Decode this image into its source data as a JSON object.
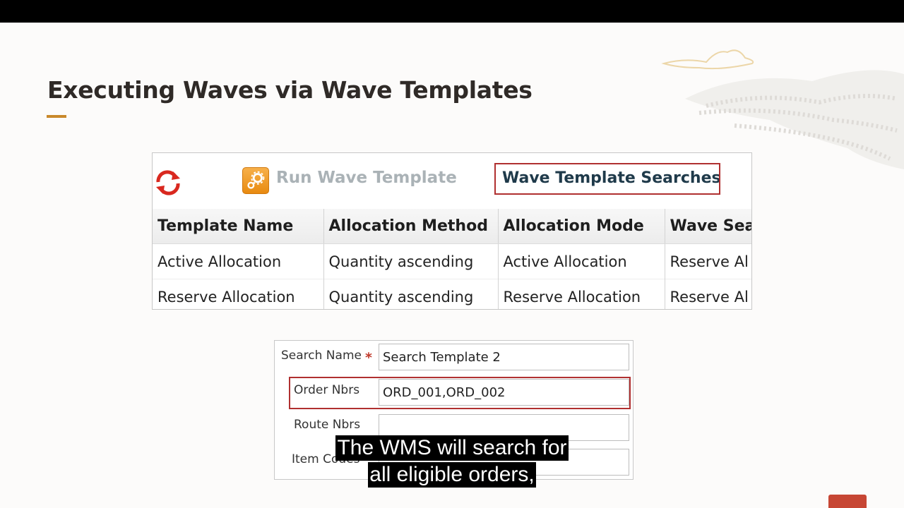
{
  "slide": {
    "title": "Executing Waves via Wave Templates"
  },
  "toolbar": {
    "refresh_icon": "refresh-icon",
    "run_icon": "gears-icon",
    "run_label": "Run Wave Template",
    "search_label": "Wave Template Searches"
  },
  "grid": {
    "columns": [
      "Template Name",
      "Allocation Method",
      "Allocation Mode",
      "Wave Sea"
    ],
    "rows": [
      [
        "Active Allocation",
        "Quantity ascending",
        "Active Allocation",
        "Reserve Al"
      ],
      [
        "Reserve Allocation",
        "Quantity ascending",
        "Reserve Allocation",
        "Reserve Al"
      ]
    ]
  },
  "form": {
    "search_name_label": "Search Name",
    "required_mark": "*",
    "search_name_value": "Search Template 2",
    "order_nbrs_label": "Order Nbrs",
    "order_nbrs_value": "ORD_001,ORD_002",
    "route_nbrs_label": "Route Nbrs",
    "route_nbrs_value": "",
    "item_codes_label": "Item Codes",
    "item_codes_value": ""
  },
  "caption": {
    "line1": "The WMS will search for",
    "line2": "all eligible orders,"
  },
  "colors": {
    "accent": "#c9892b",
    "highlight_border": "#b03030",
    "title": "#2f2a27"
  }
}
